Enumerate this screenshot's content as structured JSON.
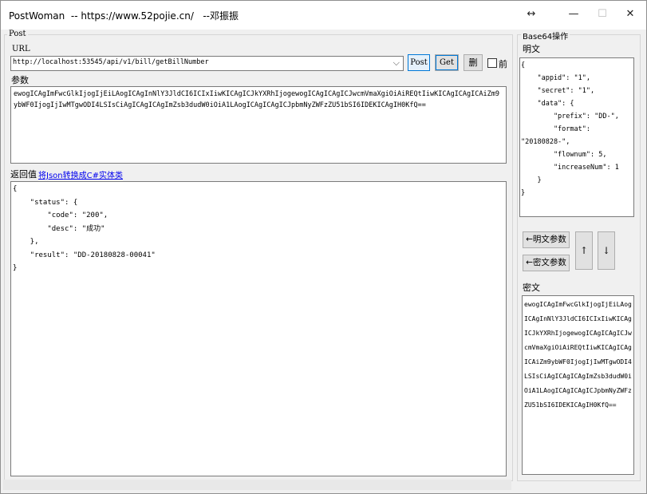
{
  "titlebar": {
    "title": "PostWoman  -- https://www.52pojie.cn/   --邓振振",
    "resize_glyph": "↔",
    "minimize_glyph": "—",
    "maximize_glyph": "☐",
    "close_glyph": "✕"
  },
  "post": {
    "group_label": "Post",
    "url_label": "URL",
    "url_value": "http://localhost:53545/api/v1/bill/getBillNumber",
    "dropdown_glyph": "⌵",
    "post_button": "Post",
    "get_button": "Get",
    "delete_button": "删",
    "front_checkbox_label": "前",
    "params_label": "参数",
    "params_value": "ewogICAgImFwcGlkIjogIjEiLAogICAgInNlY3JldCI6ICIxIiwKICAgICJkYXRhIjogewogICAgICAgICJwcmVmaXgiOiAiREQtIiwKICAgICAgICAiZm9ybWF0IjogIjIwMTgwODI4LSIsCiAgICAgICAgImZsb3dudW0iOiA1LAogICAgICAgICJpbmNyZWFzZU51bSI6IDEKICAgIH0KfQ==",
    "return_label": "返回值",
    "convert_link": "将Json转换成C#实体类",
    "return_value": "{\n    \"status\": {\n        \"code\": \"200\",\n        \"desc\": \"成功\"\n    },\n    \"result\": \"DD-20180828-00041\"\n}"
  },
  "base64": {
    "group_label": "Base64操作",
    "plain_label": "明文",
    "plain_value": "{\n    \"appid\": \"1\",\n    \"secret\": \"1\",\n    \"data\": {\n        \"prefix\": \"DD-\",\n        \"format\": \n\"20180828-\",\n        \"flownum\": 5,\n        \"increaseNum\": 1\n    }\n}",
    "plain_params_button": "←明文参数",
    "cipher_params_button": "←密文参数",
    "up_button": "↑",
    "down_button": "↓",
    "cipher_label": "密文",
    "cipher_value": "ewogICAgImFwcGlkIjogIjEiLAogICAgInNlY3JldCI6ICIxIiwKICAgICJkYXRhIjogewogICAgICAgICJwcmVmaXgiOiAiREQtIiwKICAgICAgICAiZm9ybWF0IjogIjIwMTgwODI4LSIsCiAgICAgICAgImZsb3dudW0iOiA1LAogICAgICAgICJpbmNyZWFzZU51bSI6IDEKICAgIH0KfQ=="
  }
}
